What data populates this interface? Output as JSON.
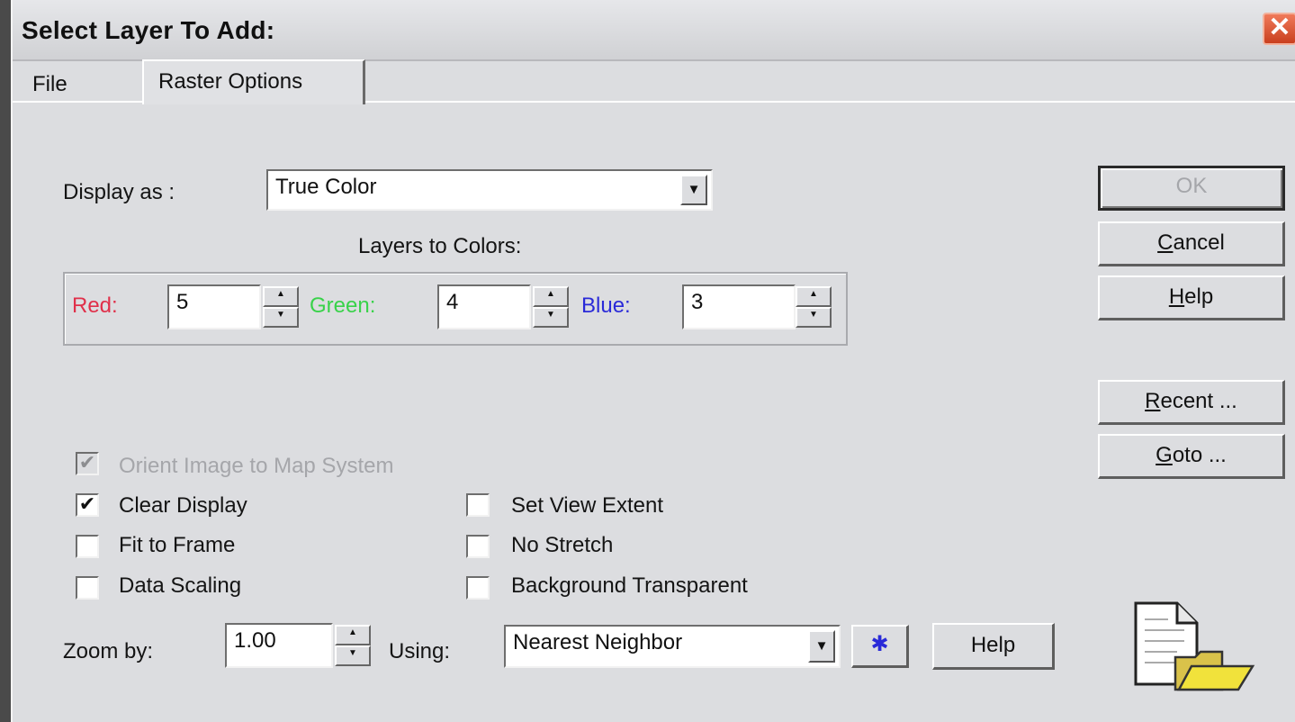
{
  "window": {
    "title": "Select Layer To Add:",
    "close_glyph": "✕"
  },
  "tabs": [
    {
      "label": "File",
      "active": false
    },
    {
      "label": "Raster Options",
      "active": true
    }
  ],
  "display_as": {
    "label": "Display as :",
    "value": "True Color"
  },
  "layers_to_colors": {
    "heading": "Layers to Colors:",
    "red": {
      "label": "Red:",
      "value": "5",
      "color": "#e0304a"
    },
    "green": {
      "label": "Green:",
      "value": "4",
      "color": "#39d24a"
    },
    "blue": {
      "label": "Blue:",
      "value": "3",
      "color": "#2a2ad8"
    }
  },
  "buttons": {
    "ok": "OK",
    "cancel": {
      "mnemonic": "C",
      "rest": "ancel"
    },
    "help": {
      "mnemonic": "H",
      "rest": "elp"
    },
    "recent": {
      "mnemonic": "R",
      "rest": "ecent ..."
    },
    "goto": {
      "mnemonic": "G",
      "rest": "oto ..."
    },
    "help_small": "Help"
  },
  "options": {
    "orient": {
      "label": "Orient Image to Map System",
      "checked": true,
      "enabled": false
    },
    "clear_display": {
      "label": "Clear Display",
      "checked": true
    },
    "fit_to_frame": {
      "label": "Fit to Frame",
      "checked": false
    },
    "data_scaling": {
      "label": "Data Scaling",
      "checked": false
    },
    "set_view_extent": {
      "label": "Set View Extent",
      "checked": false
    },
    "no_stretch": {
      "label": "No Stretch",
      "checked": false
    },
    "background_transparent": {
      "label": "Background Transparent",
      "checked": false
    }
  },
  "zoom": {
    "label": "Zoom by:",
    "value": "1.00"
  },
  "using": {
    "label": "Using:",
    "value": "Nearest Neighbor",
    "star_glyph": "✱"
  },
  "icons": {
    "file_folder": "file-folder-icon"
  },
  "glyphs": {
    "check": "✔",
    "arrow_down": "▼",
    "spin_up": "▲",
    "spin_down": "▼"
  }
}
